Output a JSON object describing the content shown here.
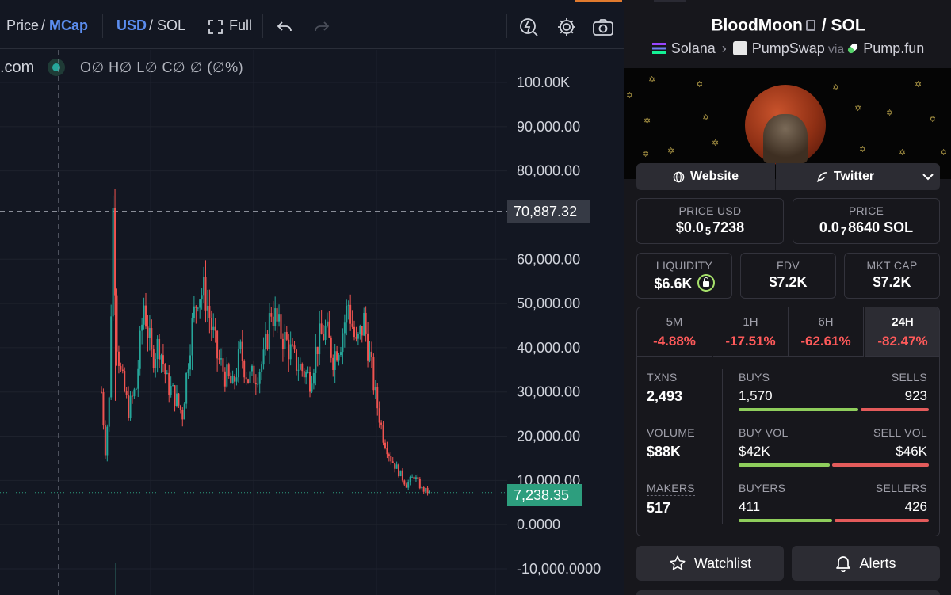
{
  "toolbar": {
    "price": "Price",
    "slash1": "/",
    "mcap": "MCap",
    "usd": "USD",
    "slash2": "/",
    "sol": "SOL",
    "full": "Full"
  },
  "legend": {
    "site": ".com",
    "ohlc": "O∅ H∅ L∅ C∅ ∅ (∅%)"
  },
  "chart_data": {
    "type": "candlestick",
    "y_axis_labels": [
      "100.00K",
      "90,000.00",
      "80,000.00",
      "70,000.00",
      "60,000.00",
      "50,000.00",
      "40,000.00",
      "30,000.00",
      "20,000.00",
      "10,000.00",
      "0.0000",
      "-10,000.0000"
    ],
    "ylim": [
      -10000,
      100000
    ],
    "crosshair_price": "70,887.32",
    "last_price": "7,238.35",
    "up_color": "#26a69a",
    "down_color": "#ef5350",
    "price_series": [
      [
        0,
        30000
      ],
      [
        2,
        17000
      ],
      [
        4,
        28000
      ],
      [
        6,
        70887
      ],
      [
        8,
        42000
      ],
      [
        10,
        34000
      ],
      [
        14,
        26000
      ],
      [
        18,
        31000
      ],
      [
        22,
        50000
      ],
      [
        26,
        38000
      ],
      [
        30,
        41000
      ],
      [
        34,
        32000
      ],
      [
        38,
        29000
      ],
      [
        42,
        25000
      ],
      [
        46,
        42000
      ],
      [
        50,
        53000
      ],
      [
        54,
        52000
      ],
      [
        56,
        47000
      ],
      [
        60,
        38000
      ],
      [
        64,
        34000
      ],
      [
        68,
        31000
      ],
      [
        72,
        39000
      ],
      [
        76,
        33000
      ],
      [
        80,
        34000
      ],
      [
        84,
        37000
      ],
      [
        88,
        49000
      ],
      [
        92,
        44000
      ],
      [
        96,
        41000
      ],
      [
        100,
        37000
      ],
      [
        104,
        35000
      ],
      [
        108,
        33000
      ],
      [
        112,
        41000
      ],
      [
        116,
        44000
      ],
      [
        120,
        38000
      ],
      [
        124,
        42000
      ],
      [
        128,
        50000
      ],
      [
        132,
        40000
      ],
      [
        136,
        46000
      ],
      [
        140,
        35000
      ],
      [
        142,
        29000
      ],
      [
        146,
        20000
      ],
      [
        150,
        15000
      ],
      [
        154,
        12000
      ],
      [
        158,
        9000
      ],
      [
        162,
        11000
      ],
      [
        166,
        8000
      ],
      [
        170,
        7238
      ]
    ]
  },
  "panel": {
    "token_name": "BloodMoon",
    "pair_slash": "/",
    "quote": "SOL",
    "chain": "Solana",
    "dex": "PumpSwap",
    "via": "via",
    "launchpad": "Pump.fun",
    "website_label": "Website",
    "twitter_label": "Twitter",
    "price_usd_label": "PRICE USD",
    "price_usd_pre": "$0.0",
    "price_usd_zeros": "5",
    "price_usd_post": "7238",
    "price_sol_label": "PRICE",
    "price_sol_pre": "0.0",
    "price_sol_zeros": "7",
    "price_sol_post": "8640 SOL",
    "liquidity_label": "LIQUIDITY",
    "liquidity_value": "$6.6K",
    "fdv_label": "FDV",
    "fdv_value": "$7.2K",
    "mcap_label": "MKT CAP",
    "mcap_value": "$7.2K",
    "timeframes": [
      {
        "label": "5M",
        "change": "-4.88%"
      },
      {
        "label": "1H",
        "change": "-17.51%"
      },
      {
        "label": "6H",
        "change": "-62.61%"
      },
      {
        "label": "24H",
        "change": "-82.47%"
      }
    ],
    "txns_label": "TXNS",
    "txns_value": "2,493",
    "buys_label": "BUYS",
    "buys_value": "1,570",
    "sells_label": "SELLS",
    "sells_value": "923",
    "buys_share": 0.63,
    "volume_label": "VOLUME",
    "volume_value": "$88K",
    "buy_vol_label": "BUY VOL",
    "buy_vol_value": "$42K",
    "sell_vol_label": "SELL VOL",
    "sell_vol_value": "$46K",
    "buy_vol_share": 0.48,
    "makers_label": "MAKERS",
    "makers_value": "517",
    "buyers_label": "BUYERS",
    "buyers_value": "411",
    "sellers_label": "SELLERS",
    "sellers_value": "426",
    "buyers_share": 0.49,
    "watchlist_label": "Watchlist",
    "alerts_label": "Alerts"
  }
}
